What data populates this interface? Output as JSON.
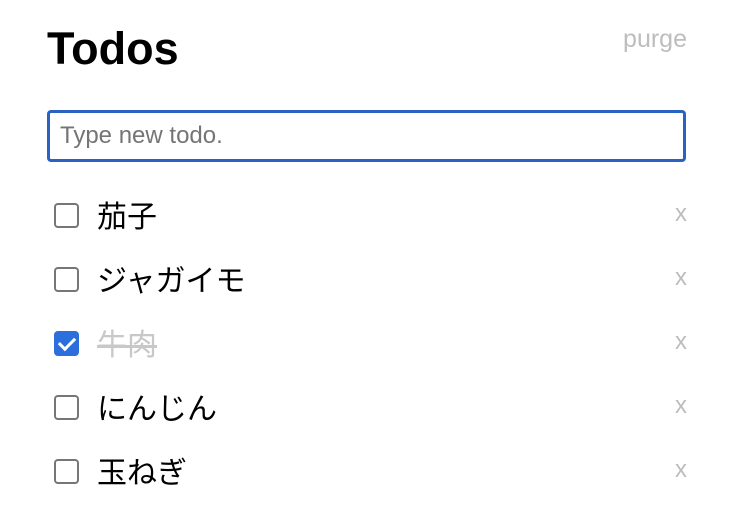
{
  "header": {
    "title": "Todos",
    "purge_label": "purge"
  },
  "new_todo": {
    "placeholder": "Type new todo.",
    "value": ""
  },
  "todos": [
    {
      "label": "茄子",
      "done": false,
      "delete_label": "x"
    },
    {
      "label": "ジャガイモ",
      "done": false,
      "delete_label": "x"
    },
    {
      "label": "牛肉",
      "done": true,
      "delete_label": "x"
    },
    {
      "label": "にんじん",
      "done": false,
      "delete_label": "x"
    },
    {
      "label": "玉ねぎ",
      "done": false,
      "delete_label": "x"
    }
  ],
  "colors": {
    "accent": "#2a62c4",
    "checkbox_checked": "#2a6fdb",
    "muted": "#bdbdbd",
    "done_text": "#c8c8c8"
  }
}
